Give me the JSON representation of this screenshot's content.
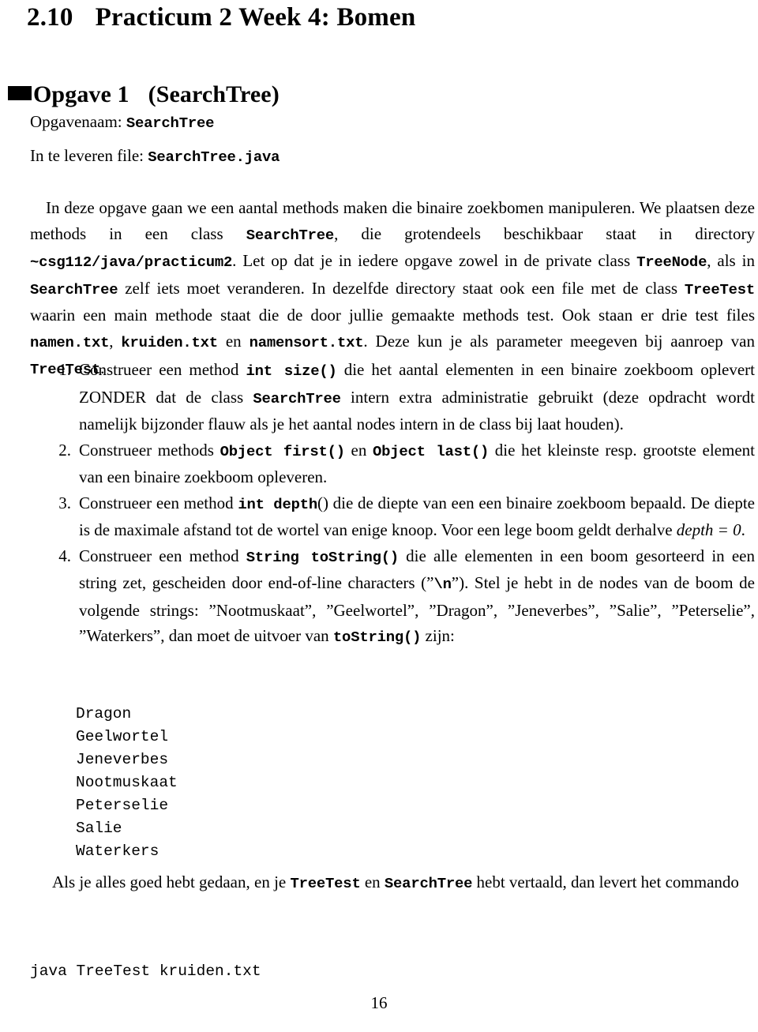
{
  "document": {
    "section_number": "2.10",
    "section_title": "Practicum 2 Week 4: Bomen",
    "page_number": "16"
  },
  "exercise": {
    "title": "Opgave 1",
    "title_paren": "(SearchTree)",
    "opgavenaam_label": "Opgavenaam:",
    "opgavenaam_value": "SearchTree",
    "deliver_label": "In te leveren file:",
    "deliver_value": "SearchTree.java"
  },
  "intro": {
    "t1": "In deze opgave gaan we een aantal methods maken die binaire zoekbomen manipuleren. We plaatsen deze methods in een class ",
    "c1": "SearchTree",
    "t2": ", die grotendeels beschikbaar staat in directory ",
    "c2": "~csg112/java/practicum2",
    "t3": ". Let op dat je in iedere opgave zowel in de private class ",
    "c3": "TreeNode",
    "t4": ", als in ",
    "c4": "SearchTree",
    "t5": " zelf iets moet veranderen. In dezelfde directory staat ook een file met de class ",
    "c5": "TreeTest",
    "t6": " waarin een main methode staat die de door jullie gemaakte methods test. Ook staan er drie test files ",
    "c6": "namen.txt",
    "t7": ", ",
    "c7": "kruiden.txt",
    "t8": " en ",
    "c8": "namensort.txt",
    "t9": ". Deze kun je als parameter meegeven bij aanroep van ",
    "c9": "TreeTest",
    "t10": "."
  },
  "enum_items": [
    {
      "marker": "1.",
      "t1": "Construeer een method ",
      "c1": "int size()",
      "t2": " die het aantal elementen in een binaire zoekboom oplevert ZONDER dat de class ",
      "c2": "SearchTree",
      "t3": " intern extra administratie gebruikt (deze opdracht wordt namelijk bijzonder flauw als je het aantal nodes intern in de class bij laat houden)."
    },
    {
      "marker": "2.",
      "t1": "Construeer methods ",
      "c1": "Object first()",
      "t2": " en ",
      "c2": "Object last()",
      "t3": " die het kleinste resp. grootste element van een binaire zoekboom opleveren."
    },
    {
      "marker": "3.",
      "t1": "Construeer een method ",
      "c1": "int depth",
      "t2": "() die de diepte van een een binaire zoekboom bepaald. De diepte is de maximale afstand tot de wortel van enige knoop. Voor een lege boom geldt derhalve ",
      "m1": "depth = 0",
      "t3": "."
    },
    {
      "marker": "4.",
      "t1": "Construeer een method ",
      "c1": "String toString()",
      "t2": " die alle elementen in een boom gesorteerd in een string zet, gescheiden door end-of-line characters (”",
      "c2": "\\n",
      "t3": "”). Stel je hebt in de nodes van de boom de volgende strings: ”Nootmuskaat”, ”Geelwortel”, ”Dragon”, ”Jeneverbes”, ”Salie”, ”Peterselie”, ”Waterkers”, dan moet de uitvoer van ",
      "c3": "toString()",
      "t4": " zijn:"
    }
  ],
  "verbatim_output": "Dragon\nGeelwortel\nJeneverbes\nNootmuskaat\nPeterselie\nSalie\nWaterkers",
  "closing": {
    "t1": "Als je alles goed hebt gedaan, en je ",
    "c1": "TreeTest",
    "t2": " en ",
    "c2": "SearchTree",
    "t3": " hebt vertaald, dan levert het commando"
  },
  "verbatim_command": "java TreeTest kruiden.txt"
}
